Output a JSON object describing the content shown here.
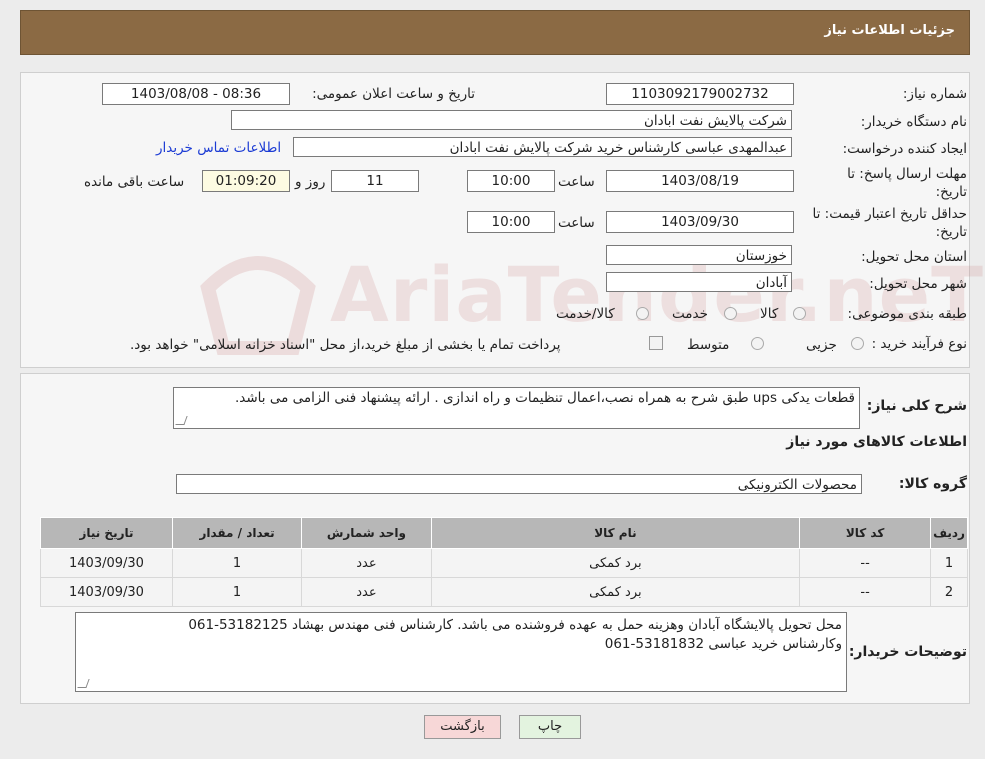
{
  "header": {
    "title": "جزئیات اطلاعات نیاز"
  },
  "watermark": "AriaTender.neT",
  "form": {
    "need_number_label": "شماره نیاز:",
    "need_number": "1103092179002732",
    "announce_label": "تاریخ و ساعت اعلان عمومی:",
    "announce_value": "1403/08/08 - 08:36",
    "buyer_org_label": "نام دستگاه خریدار:",
    "buyer_org": "شرکت پالایش نفت ابادان",
    "creator_label": "ایجاد کننده درخواست:",
    "creator": "عبدالمهدی  عباسی کارشناس خرید شرکت پالایش نفت ابادان",
    "contact_link": "اطلاعات تماس خریدار",
    "deadline_label_1": "مهلت ارسال پاسخ: تا",
    "deadline_label_2": "تاریخ:",
    "deadline_date": "1403/08/19",
    "time_label": "ساعت",
    "deadline_time": "10:00",
    "days_value": "11",
    "days_label": "روز و",
    "remaining_time": "01:09:20",
    "remaining_label": "ساعت باقی مانده",
    "validity_label_1": "حداقل تاریخ اعتبار قیمت: تا",
    "validity_label_2": "تاریخ:",
    "validity_date": "1403/09/30",
    "validity_time": "10:00",
    "province_label": "استان محل تحویل:",
    "province": "خوزستان",
    "city_label": "شهر محل تحویل:",
    "city": "آبادان",
    "category_label": "طبقه بندی موضوعی:",
    "category_options": [
      "کالا",
      "خدمت",
      "کالا/خدمت"
    ],
    "process_label": "نوع فرآیند خرید :",
    "process_options": [
      "جزیی",
      "متوسط"
    ],
    "process_note": "پرداخت تمام یا بخشی از مبلغ خرید،از محل \"اسناد خزانه اسلامی\" خواهد بود."
  },
  "description": {
    "label": "شرح کلی نیاز:",
    "text": "قطعات یدکی ups طبق شرح به همراه نصب،اعمال تنظیمات و راه اندازی . ارائه پیشنهاد فنی الزامی می باشد."
  },
  "goods": {
    "title": "اطلاعات کالاهای مورد نیاز",
    "group_label": "گروه کالا:",
    "group_value": "محصولات الکترونیکی",
    "columns": [
      "ردیف",
      "کد کالا",
      "نام کالا",
      "واحد شمارش",
      "تعداد / مقدار",
      "تاریخ نیاز"
    ],
    "rows": [
      {
        "row": "1",
        "code": "--",
        "name": "برد کمکی",
        "unit": "عدد",
        "qty": "1",
        "date": "1403/09/30"
      },
      {
        "row": "2",
        "code": "--",
        "name": "برد کمکی",
        "unit": "عدد",
        "qty": "1",
        "date": "1403/09/30"
      }
    ]
  },
  "buyer_notes": {
    "label": "توضیحات خریدار:",
    "line1": "محل تحویل پالایشگاه آبادان وهزینه حمل به عهده فروشنده می باشد. کارشناس فنی مهندس بهشاد 53182125-061",
    "line2": "وکارشناس خرید عباسی 53181832-061"
  },
  "buttons": {
    "print": "چاپ",
    "back": "بازگشت"
  },
  "colors": {
    "header_bg": "#8b6a44",
    "link": "#1b3bd4",
    "back_button": "#f7d7d7",
    "print_button": "#e3f3df"
  }
}
